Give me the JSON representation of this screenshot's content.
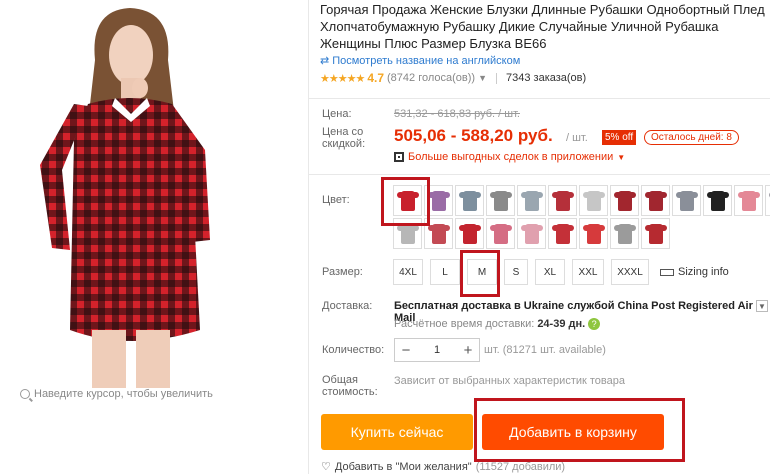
{
  "zoom_hint": "Наведите курсор, чтобы увеличить",
  "product": {
    "title": "Горячая Продажа Женские Блузки Длинные Рубашки Однобортный Плед Хлопчатобумажную Рубашку Дикие Случайные Уличной Рубашка Женщины Плюс Размер Блузка BE66",
    "translate_link": "Посмотреть название на английском",
    "rating_stars": "★★★★★",
    "rating_value": "4.7",
    "votes": "(8742 голоса(ов))",
    "orders": "7343 заказа(ов)"
  },
  "price": {
    "label_price": "Цена:",
    "old_price": "531,32 - 618,83 руб. / шт.",
    "label_discount_line1": "Цена со",
    "label_discount_line2": "скидкой:",
    "sale_price": "505,06 - 588,20 руб.",
    "per_unit": "/ шт.",
    "discount_badge": "5% off",
    "days_left": "Осталось дней: 8",
    "app_deals": "Больше выгодных сделок в приложении"
  },
  "color": {
    "label": "Цвет:",
    "swatch_colors": [
      "#c8202c",
      "#9a6ca6",
      "#7d8f9e",
      "#8a8a8a",
      "#9aa6b0",
      "#b5303a",
      "#c6c6c6",
      "#a2262e",
      "#a1262f",
      "#8a8f99",
      "#222",
      "#e48896",
      "#a19fa7",
      "#b7b7b7",
      "#c34a54",
      "#c3242f",
      "#d56d84",
      "#e0a0ae",
      "#c43038",
      "#d63a3c",
      "#9b9b9b",
      "#b62a30"
    ]
  },
  "size": {
    "label": "Размер:",
    "options": [
      "4XL",
      "L",
      "M",
      "S",
      "XL",
      "XXL",
      "XXXL"
    ],
    "sizing_info": "Sizing info"
  },
  "shipping": {
    "label": "Доставка:",
    "main": "Бесплатная доставка в Ukraine службой China Post Registered Air Mail",
    "time_prefix": "Расчётное время доставки:",
    "time_value": "24-39 дн."
  },
  "quantity": {
    "label": "Количество:",
    "value": "1",
    "note": "шт. (81271 шт. available)"
  },
  "total": {
    "label_line1": "Общая",
    "label_line2": "стоимость:",
    "note": "Зависит от выбранных характеристик товара"
  },
  "actions": {
    "buy_now": "Купить сейчас",
    "add_to_cart": "Добавить в корзину",
    "wishlist": "Добавить в \"Мои желания\"",
    "wishlist_count": "(11527 добавили)"
  }
}
